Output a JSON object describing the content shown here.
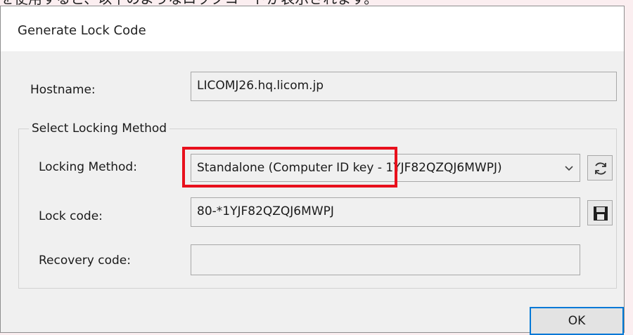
{
  "document": {
    "caption_fragment": "を使用すると、以下のようなロックコードが表示されます。"
  },
  "dialog": {
    "title": "Generate Lock Code",
    "hostname": {
      "label": "Hostname:",
      "value": "LICOMJ26.hq.licom.jp"
    },
    "locking_group": {
      "title": "Select Locking Method",
      "method": {
        "label": "Locking Method:",
        "selected": "Standalone (Computer ID key - 1YJF82QZQJ6MWPJ)"
      },
      "lock_code": {
        "label": "Lock code:",
        "value": "80-*1YJF82QZQJ6MWPJ"
      },
      "recovery_code": {
        "label": "Recovery code:",
        "value": ""
      }
    },
    "ok_label": "OK"
  },
  "icons": {
    "refresh": "refresh-icon",
    "save": "save-icon",
    "dropdown": "chevron-down-icon"
  },
  "colors": {
    "highlight": "#e8101c",
    "ok_border": "#0078d7",
    "page_background": "#fbeef0"
  }
}
